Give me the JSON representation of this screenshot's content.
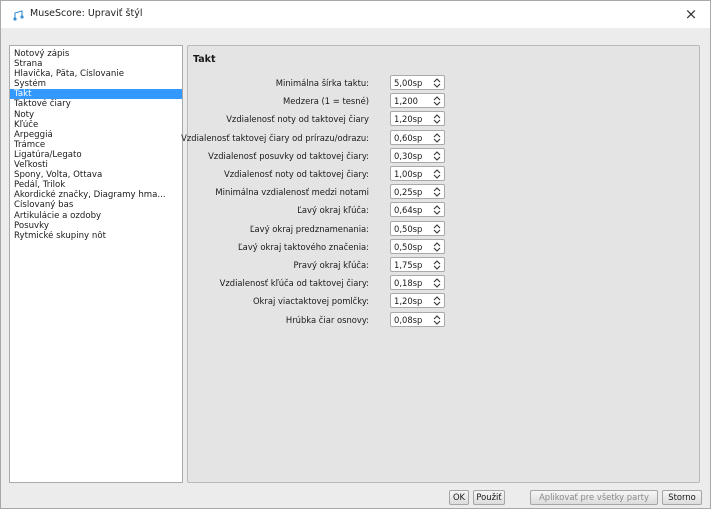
{
  "window": {
    "title": "MuseScore: Upraviť štýl",
    "close_glyph": "×",
    "app_icon": "musescore-icon"
  },
  "sidebar": {
    "selected": "Takt",
    "items": [
      "Notový zápis",
      "Strana",
      "Hlavička, Päta, Číslovanie",
      "Systém",
      "Takt",
      "Taktové čiary",
      "Noty",
      "Kľúče",
      "Arpeggiá",
      "Trámce",
      "Ligatúra/Legato",
      "Veľkosti",
      "Spony, Volta, Ottava",
      "Pedál, Trilok",
      "Akordické značky, Diagramy hma...",
      "Číslovaný bas",
      "Artikulácie a ozdoby",
      "Posuvky",
      "Rytmické skupiny nôt"
    ]
  },
  "panel": {
    "title": "Takt",
    "settings": [
      {
        "label": "Minimálna šírka taktu:",
        "value": "5,00sp"
      },
      {
        "label": "Medzera (1 = tesné)",
        "value": "1,200"
      },
      {
        "label": "Vzdialenosť noty od taktovej čiary",
        "value": "1,20sp"
      },
      {
        "label": "Vzdialenosť taktovej čiary od prírazu/odrazu:",
        "value": "0,60sp"
      },
      {
        "label": "Vzdialenosť posuvky od taktovej čiary:",
        "value": "0,30sp"
      },
      {
        "label": "Vzdialenosť noty od taktovej čiary:",
        "value": "1,00sp"
      },
      {
        "label": "Minimálna vzdialenosť medzi notami",
        "value": "0,25sp"
      },
      {
        "label": "Ľavý okraj kľúča:",
        "value": "0,64sp"
      },
      {
        "label": "Ľavý okraj predznamenania:",
        "value": "0,50sp"
      },
      {
        "label": "Ľavý okraj taktového značenia:",
        "value": "0,50sp"
      },
      {
        "label": "Pravý okraj kľúča:",
        "value": "1,75sp"
      },
      {
        "label": "Vzdialenosť kľúča od taktovej čiary:",
        "value": "0,18sp"
      },
      {
        "label": "Okraj viactaktovej pomlčky:",
        "value": "1,20sp"
      },
      {
        "label": "Hrúbka čiar osnovy:",
        "value": "0,08sp"
      }
    ]
  },
  "buttons": {
    "ok": "OK",
    "apply": "Použiť",
    "apply_all": "Aplikovať pre všetky party",
    "cancel": "Storno"
  }
}
